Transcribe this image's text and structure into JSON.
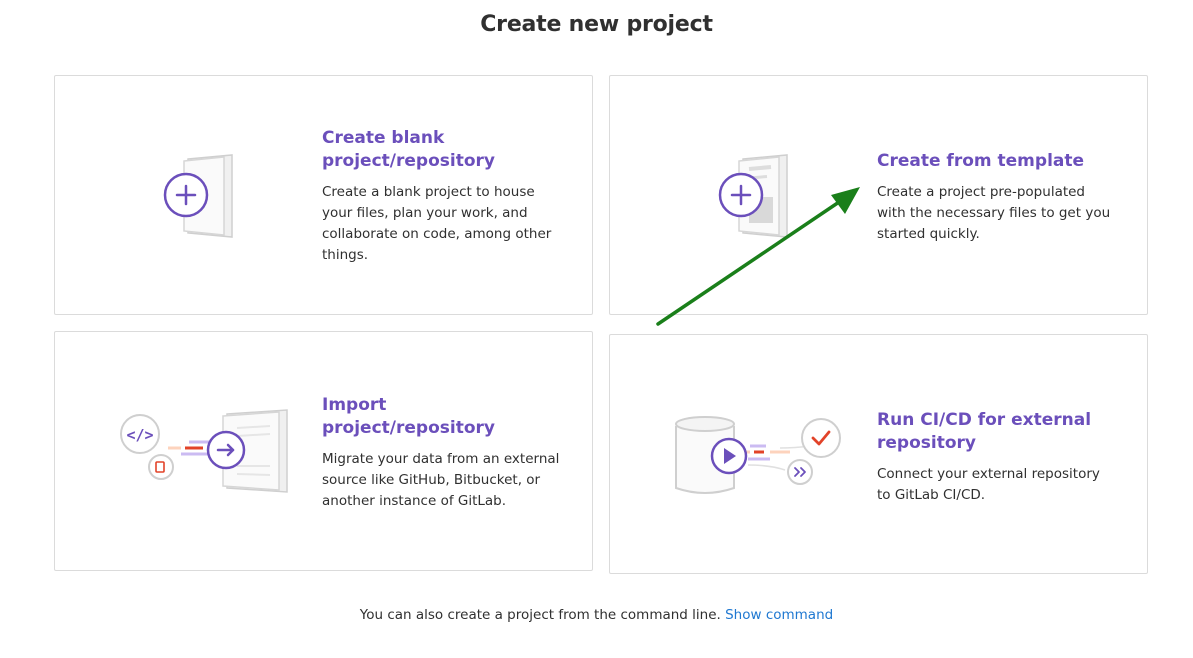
{
  "page": {
    "title": "Create new project"
  },
  "cards": [
    {
      "title": "Create blank project/repository",
      "description": "Create a blank project to house your files, plan your work, and collaborate on code, among other things."
    },
    {
      "title": "Create from template",
      "description": "Create a project pre-populated with the necessary files to get you started quickly."
    },
    {
      "title": "Import project/repository",
      "description": "Migrate your data from an external source like GitHub, Bitbucket, or another instance of GitLab."
    },
    {
      "title": "Run CI/CD for external repository",
      "description": "Connect your external repository to GitLab CI/CD."
    }
  ],
  "footer": {
    "text": "You can also create a project from the command line.",
    "link": "Show command"
  },
  "colors": {
    "accent_purple": "#6b4fbb",
    "accent_orange": "#e24329",
    "link_blue": "#1f78d1",
    "annotation_arrow": "#1a7f1a"
  }
}
